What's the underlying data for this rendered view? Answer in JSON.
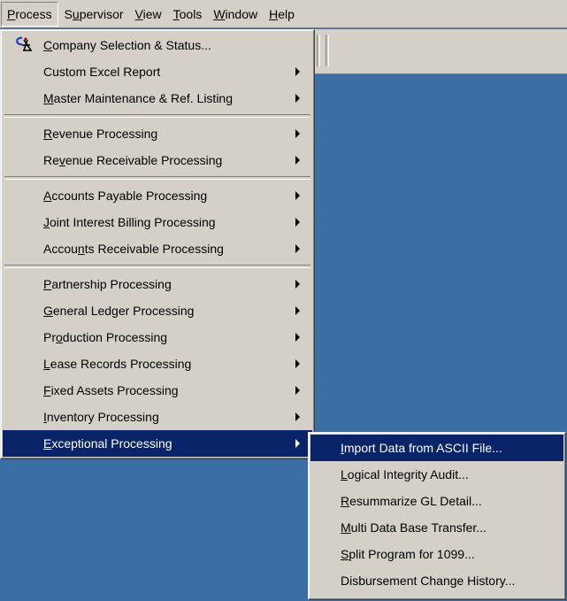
{
  "menubar": {
    "items": [
      {
        "pre": "",
        "key": "P",
        "post": "rocess"
      },
      {
        "pre": "S",
        "key": "u",
        "post": "pervisor"
      },
      {
        "pre": "",
        "key": "V",
        "post": "iew"
      },
      {
        "pre": "",
        "key": "T",
        "post": "ools"
      },
      {
        "pre": "",
        "key": "W",
        "post": "indow"
      },
      {
        "pre": "",
        "key": "H",
        "post": "elp"
      }
    ]
  },
  "main_menu": {
    "items": [
      {
        "pre": "",
        "key": "C",
        "post": "ompany Selection & Status...",
        "submenu": false,
        "icon": "company-selection-icon"
      },
      {
        "pre": "Custom Excel Report",
        "key": "",
        "post": "",
        "submenu": true
      },
      {
        "pre": "",
        "key": "M",
        "post": "aster Maintenance & Ref. Listing",
        "submenu": true
      },
      {
        "pre": "",
        "key": "R",
        "post": "evenue Processing",
        "submenu": true
      },
      {
        "pre": "Re",
        "key": "v",
        "post": "enue Receivable Processing",
        "submenu": true
      },
      {
        "pre": "",
        "key": "A",
        "post": "ccounts Payable Processing",
        "submenu": true
      },
      {
        "pre": "",
        "key": "J",
        "post": "oint Interest Billing Processing",
        "submenu": true
      },
      {
        "pre": "Accou",
        "key": "n",
        "post": "ts Receivable Processing",
        "submenu": true
      },
      {
        "pre": "",
        "key": "P",
        "post": "artnership Processing",
        "submenu": true
      },
      {
        "pre": "",
        "key": "G",
        "post": "eneral Ledger Processing",
        "submenu": true
      },
      {
        "pre": "Pr",
        "key": "o",
        "post": "duction Processing",
        "submenu": true
      },
      {
        "pre": "",
        "key": "L",
        "post": "ease Records Processing",
        "submenu": true
      },
      {
        "pre": "",
        "key": "F",
        "post": "ixed Assets Processing",
        "submenu": true
      },
      {
        "pre": "",
        "key": "I",
        "post": "nventory Processing",
        "submenu": true
      },
      {
        "pre": "",
        "key": "E",
        "post": "xceptional Processing",
        "submenu": true
      }
    ]
  },
  "sub_menu": {
    "items": [
      {
        "pre": "",
        "key": "I",
        "post": "mport Data from ASCII File..."
      },
      {
        "pre": "",
        "key": "L",
        "post": "ogical Integrity Audit..."
      },
      {
        "pre": "",
        "key": "R",
        "post": "esummarize GL Detail..."
      },
      {
        "pre": "",
        "key": "M",
        "post": "ulti Data Base Transfer..."
      },
      {
        "pre": "",
        "key": "S",
        "post": "plit Program for 1099..."
      },
      {
        "pre": "Disbursement Change History...",
        "key": "",
        "post": ""
      }
    ]
  },
  "colors": {
    "desktop": "#3a6ea5",
    "menu_face": "#d4d0c8",
    "highlight": "#0a246a"
  }
}
